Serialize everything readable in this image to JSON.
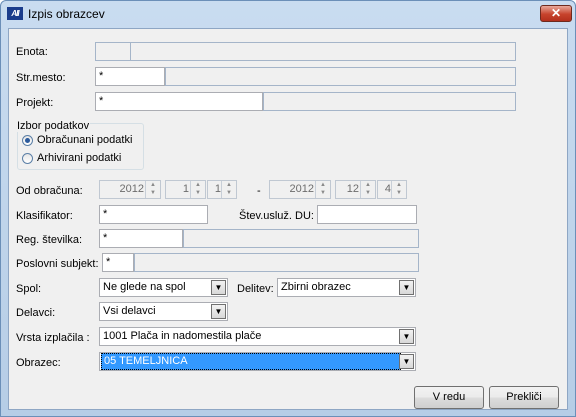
{
  "window": {
    "title": "Izpis obrazcev",
    "close_label": "✕",
    "icon": "app-logo-icon",
    "icon_text": "AII"
  },
  "fields": {
    "enota": {
      "label": "Enota:",
      "code": "",
      "name": ""
    },
    "str_mesto": {
      "label": "Str.mesto:",
      "code": "*",
      "name": ""
    },
    "projekt": {
      "label": "Projekt:",
      "code": "*",
      "name": ""
    }
  },
  "izbor": {
    "title": "Izbor podatkov",
    "options": [
      {
        "label": "Obračunani podatki",
        "selected": true
      },
      {
        "label": "Arhivirani podatki",
        "selected": false
      }
    ]
  },
  "od_obracuna": {
    "label": "Od obračuna:",
    "from": {
      "year": "2012",
      "month": "1",
      "num": "1"
    },
    "dash": "-",
    "to": {
      "year": "2012",
      "month": "12",
      "num": "4"
    }
  },
  "klasifikator": {
    "label": "Klasifikator:",
    "value": "*"
  },
  "stev_usluz": {
    "label": "Štev.usluž. DU:",
    "value": ""
  },
  "reg_stevilka": {
    "label": "Reg. številka:",
    "code": "*",
    "name": ""
  },
  "poslovni_subjekt": {
    "label": "Poslovni subjekt:",
    "code": "*",
    "name": ""
  },
  "spol": {
    "label": "Spol:",
    "value": "Ne glede na spol"
  },
  "delitev": {
    "label": "Delitev:",
    "value": "Zbirni obrazec"
  },
  "delavci": {
    "label": "Delavci:",
    "value": "Vsi delavci"
  },
  "vrsta_izplacila": {
    "label": "Vrsta izplačila :",
    "value": "1001  Plača in nadomestila plače"
  },
  "obrazec": {
    "label": "Obrazec:",
    "value": "05 TEMELJNICA"
  },
  "buttons": {
    "ok": "V redu",
    "cancel": "Prekliči"
  },
  "colors": {
    "title_gradient_top": "#c9dcf0",
    "selection": "#3399ff",
    "close_button": "#c7432c"
  }
}
